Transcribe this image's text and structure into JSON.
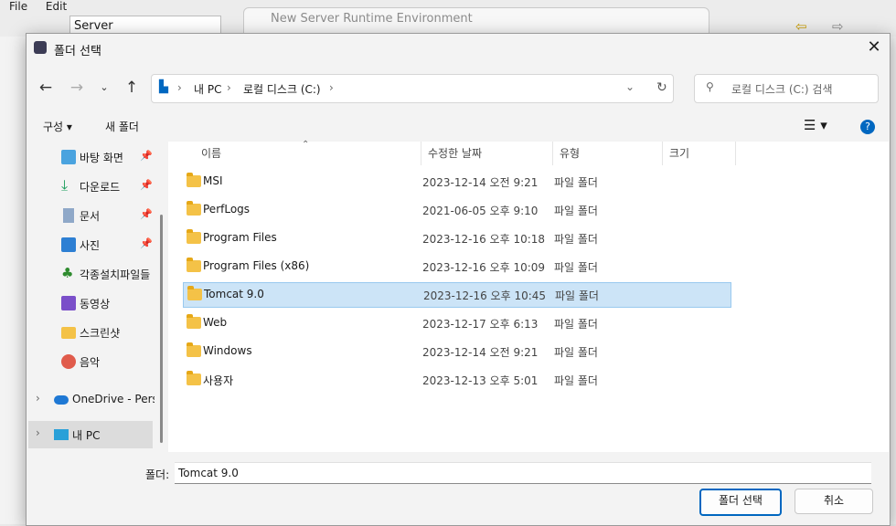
{
  "ide": {
    "menu": [
      "File",
      "Edit"
    ],
    "server_tab": "Server"
  },
  "background_window": {
    "title": "New Server Runtime Environment"
  },
  "dialog": {
    "title": "폴더 선택",
    "breadcrumb": [
      "내 PC",
      "로컬 디스크 (C:)"
    ],
    "search_placeholder": "로컬 디스크 (C:) 검색",
    "toolbar": {
      "organize": "구성",
      "new_folder": "새 폴더"
    },
    "sidebar": [
      {
        "label": "바탕 화면",
        "icon": "desktop-icon",
        "pinned": true
      },
      {
        "label": "다운로드",
        "icon": "download-icon",
        "pinned": true
      },
      {
        "label": "문서",
        "icon": "document-icon",
        "pinned": true
      },
      {
        "label": "사진",
        "icon": "pictures-icon",
        "pinned": true
      },
      {
        "label": "각종설치파일들",
        "icon": "tree-icon",
        "pinned": false
      },
      {
        "label": "동영상",
        "icon": "video-icon",
        "pinned": false
      },
      {
        "label": "스크린샷",
        "icon": "folder-icon",
        "pinned": false
      },
      {
        "label": "음악",
        "icon": "music-icon",
        "pinned": false
      },
      {
        "label": "OneDrive - Personal",
        "icon": "cloud-icon",
        "pinned": false
      },
      {
        "label": "내 PC",
        "icon": "pc-icon",
        "pinned": false
      }
    ],
    "columns": [
      "이름",
      "수정한 날짜",
      "유형",
      "크기"
    ],
    "files": [
      {
        "name": "MSI",
        "date": "2023-12-14 오전 9:21",
        "type": "파일 폴더"
      },
      {
        "name": "PerfLogs",
        "date": "2021-06-05 오후 9:10",
        "type": "파일 폴더"
      },
      {
        "name": "Program Files",
        "date": "2023-12-16 오후 10:18",
        "type": "파일 폴더"
      },
      {
        "name": "Program Files (x86)",
        "date": "2023-12-16 오후 10:09",
        "type": "파일 폴더"
      },
      {
        "name": "Tomcat 9.0",
        "date": "2023-12-16 오후 10:45",
        "type": "파일 폴더"
      },
      {
        "name": "Web",
        "date": "2023-12-17 오후 6:13",
        "type": "파일 폴더"
      },
      {
        "name": "Windows",
        "date": "2023-12-14 오전 9:21",
        "type": "파일 폴더"
      },
      {
        "name": "사용자",
        "date": "2023-12-13 오후 5:01",
        "type": "파일 폴더"
      }
    ],
    "folder_label": "폴더:",
    "folder_value": "Tomcat 9.0",
    "select_button": "폴더 선택",
    "cancel_button": "취소"
  }
}
